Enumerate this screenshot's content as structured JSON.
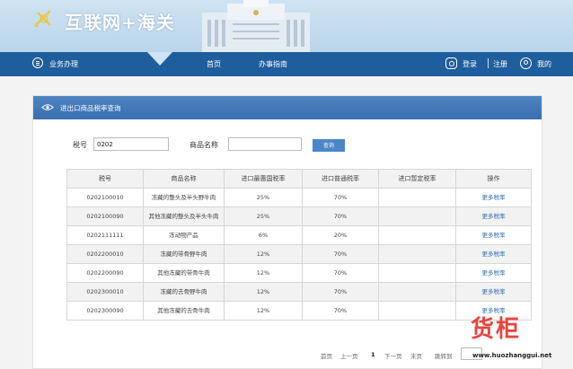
{
  "header": {
    "site_title": "互联网+海关"
  },
  "nav": {
    "business": "业务办理",
    "home": "首页",
    "guide": "办事指南",
    "login": "登录",
    "register": "注册",
    "mine": "我的"
  },
  "panel": {
    "title": "进出口商品税率查询"
  },
  "search": {
    "tax_label": "税号",
    "tax_value": "0202",
    "name_label": "商品名称",
    "name_value": "",
    "query_button": "查询"
  },
  "table": {
    "columns": [
      "税号",
      "商品名称",
      "进口最惠国税率",
      "进口普通税率",
      "进口暂定税率",
      "操作"
    ],
    "rows": [
      [
        "0202100010",
        "冻藏的整头及半头野牛肉",
        "25%",
        "70%",
        "",
        "更多税率"
      ],
      [
        "0202100090",
        "其他冻藏的整头及半头牛肉",
        "25%",
        "70%",
        "",
        "更多税率"
      ],
      [
        "0202111111",
        "冻动物产品",
        "6%",
        "20%",
        "",
        "更多税率"
      ],
      [
        "0202200010",
        "冻藏的带骨野牛肉",
        "12%",
        "70%",
        "",
        "更多税率"
      ],
      [
        "0202200090",
        "其他冻藏的带骨牛肉",
        "12%",
        "70%",
        "",
        "更多税率"
      ],
      [
        "0202300010",
        "冻藏的去骨野牛肉",
        "12%",
        "70%",
        "",
        "更多税率"
      ],
      [
        "0202300090",
        "其他冻藏的去骨牛肉",
        "12%",
        "70%",
        "",
        "更多税率"
      ]
    ]
  },
  "pager": {
    "first": "首页",
    "prev": "上一页",
    "current": "1",
    "next": "下一页",
    "last": "末页",
    "jump": "跳转到"
  },
  "watermark": {
    "text": "货柜",
    "url": "www.huozhanggui.net"
  },
  "colors": {
    "nav": "#1f5e9c",
    "panel_header": "#3a6fb0",
    "link": "#2f6fb3",
    "watermark": "#e8453c"
  }
}
